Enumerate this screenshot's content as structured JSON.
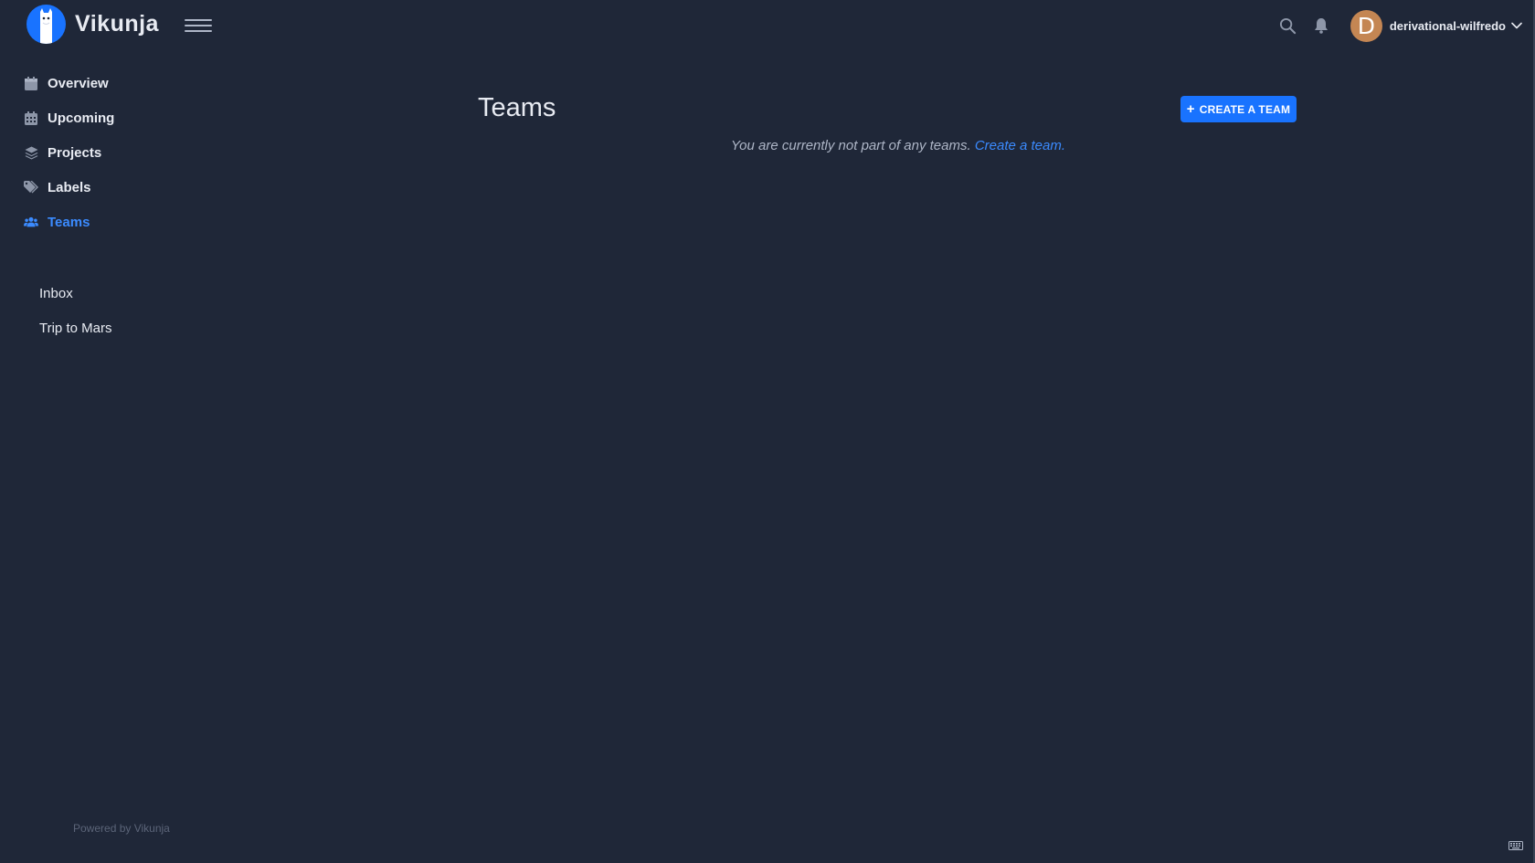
{
  "app": {
    "name": "Vikunja"
  },
  "header": {
    "user": {
      "initial": "D",
      "name": "derivational-wilfredo"
    },
    "icons": [
      "search-icon",
      "bell-icon",
      "chevron-down-icon"
    ]
  },
  "sidebar": {
    "nav": [
      {
        "label": "Overview",
        "icon": "calendar-icon"
      },
      {
        "label": "Upcoming",
        "icon": "calendar-grid-icon"
      },
      {
        "label": "Projects",
        "icon": "layers-icon"
      },
      {
        "label": "Labels",
        "icon": "tags-icon"
      },
      {
        "label": "Teams",
        "icon": "users-icon",
        "active": true
      }
    ],
    "projects": [
      {
        "label": "Inbox"
      },
      {
        "label": "Trip to Mars"
      }
    ],
    "footer": "Powered by Vikunja"
  },
  "main": {
    "title": "Teams",
    "create_button": "CREATE A TEAM",
    "empty_text": "You are currently not part of any teams.",
    "empty_link": "Create a team."
  },
  "colors": {
    "background": "#1f2738",
    "primary": "#1973ff",
    "link": "#3b8bff",
    "avatar": "#c48653"
  }
}
